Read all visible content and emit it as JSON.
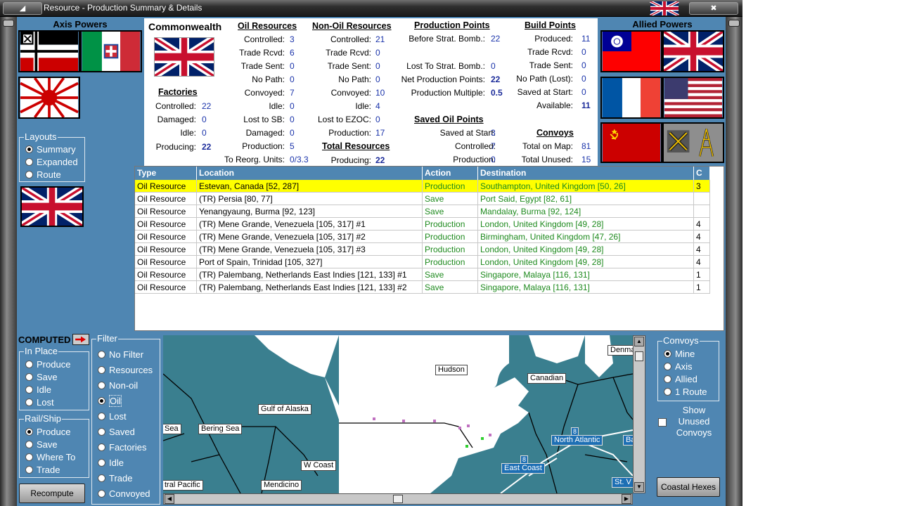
{
  "window": {
    "title": "Resource - Production Summary & Details"
  },
  "axis_header": "Axis Powers",
  "allied_header": "Allied Powers",
  "country": "Commonwealth",
  "factories": {
    "title": "Factories",
    "rows": [
      {
        "label": "Controlled:",
        "value": "22"
      },
      {
        "label": "Damaged:",
        "value": "0"
      },
      {
        "label": "Idle:",
        "value": "0"
      },
      {
        "label": "Producing:",
        "value": "22"
      }
    ]
  },
  "oil": {
    "title": "Oil Resources",
    "rows": [
      {
        "label": "Controlled:",
        "value": "3"
      },
      {
        "label": "Trade Rcvd:",
        "value": "6"
      },
      {
        "label": "Trade Sent:",
        "value": "0"
      },
      {
        "label": "No Path:",
        "value": "0"
      },
      {
        "label": "Convoyed:",
        "value": "7"
      },
      {
        "label": "Idle:",
        "value": "0"
      },
      {
        "label": "Lost to SB:",
        "value": "0"
      },
      {
        "label": "Damaged:",
        "value": "0"
      },
      {
        "label": "Production:",
        "value": "5"
      },
      {
        "label": "To Reorg. Units:",
        "value": "0/3.3"
      }
    ]
  },
  "nonoil": {
    "title": "Non-Oil Resources",
    "rows": [
      {
        "label": "Controlled:",
        "value": "21"
      },
      {
        "label": "Trade Rcvd:",
        "value": "0"
      },
      {
        "label": "Trade Sent:",
        "value": "0"
      },
      {
        "label": "No Path:",
        "value": "0"
      },
      {
        "label": "Convoyed:",
        "value": "10"
      },
      {
        "label": "Idle:",
        "value": "4"
      },
      {
        "label": "Lost to EZOC:",
        "value": "0"
      },
      {
        "label": "Production:",
        "value": "17"
      }
    ]
  },
  "total_resources": {
    "title": "Total Resources",
    "label": "Producing:",
    "value": "22"
  },
  "production_points": {
    "title": "Production Points",
    "rows": [
      {
        "label": "Before Strat. Bomb.:",
        "value": "22"
      },
      {
        "label": "Lost To Strat. Bomb.:",
        "value": "0"
      },
      {
        "label": "Net Production Points:",
        "value": "22"
      },
      {
        "label": "Production Multiple:",
        "value": "0.5"
      }
    ]
  },
  "saved_oil": {
    "title": "Saved Oil Points",
    "rows": [
      {
        "label": "Saved at Start:",
        "value": "3"
      },
      {
        "label": "Controlled:",
        "value": "7"
      },
      {
        "label": "Production:",
        "value": "0"
      }
    ]
  },
  "build_points": {
    "title": "Build Points",
    "rows": [
      {
        "label": "Produced:",
        "value": "11"
      },
      {
        "label": "Trade Rcvd:",
        "value": "0"
      },
      {
        "label": "Trade Sent:",
        "value": "0"
      },
      {
        "label": "No Path (Lost):",
        "value": "0"
      },
      {
        "label": "Saved at Start:",
        "value": "0"
      },
      {
        "label": "Available:",
        "value": "11"
      }
    ]
  },
  "convoys": {
    "title": "Convoys",
    "rows": [
      {
        "label": "Total on Map:",
        "value": "81"
      },
      {
        "label": "Total Unused:",
        "value": "15"
      }
    ]
  },
  "layouts": {
    "title": "Layouts",
    "options": [
      "Summary",
      "Expanded",
      "Route"
    ],
    "selected": 0
  },
  "table": {
    "columns": [
      "Type",
      "Location",
      "Action",
      "Destination",
      "C"
    ],
    "rows": [
      {
        "type": "Oil Resource",
        "location": "Estevan, Canada [52, 287]",
        "action": "Production",
        "destination": "Southampton, United Kingdom [50, 26]",
        "c": "3"
      },
      {
        "type": "Oil Resource",
        "location": "(TR) Persia [80, 77]",
        "action": "Save",
        "destination": "Port Said, Egypt [82, 61]",
        "c": ""
      },
      {
        "type": "Oil Resource",
        "location": "Yenangyaung, Burma [92, 123]",
        "action": "Save",
        "destination": "Mandalay, Burma [92, 124]",
        "c": ""
      },
      {
        "type": "Oil Resource",
        "location": "(TR) Mene Grande, Venezuela [105, 317] #1",
        "action": "Production",
        "destination": "London, United Kingdom [49, 28]",
        "c": "4"
      },
      {
        "type": "Oil Resource",
        "location": "(TR) Mene Grande, Venezuela [105, 317] #2",
        "action": "Production",
        "destination": "Birmingham, United Kingdom [47, 26]",
        "c": "4"
      },
      {
        "type": "Oil Resource",
        "location": "(TR) Mene Grande, Venezuela [105, 317] #3",
        "action": "Production",
        "destination": "London, United Kingdom [49, 28]",
        "c": "4"
      },
      {
        "type": "Oil Resource",
        "location": "Port of Spain, Trinidad [105, 327]",
        "action": "Production",
        "destination": "London, United Kingdom [49, 28]",
        "c": "4"
      },
      {
        "type": "Oil Resource",
        "location": "(TR) Palembang, Netherlands East Indies [121, 133] #1",
        "action": "Save",
        "destination": "Singapore, Malaya [116, 131]",
        "c": "1"
      },
      {
        "type": "Oil Resource",
        "location": "(TR) Palembang, Netherlands East Indies [121, 133] #2",
        "action": "Save",
        "destination": "Singapore, Malaya [116, 131]",
        "c": "1"
      }
    ]
  },
  "computed_label": "COMPUTED",
  "in_place": {
    "title": "In Place",
    "options": [
      "Produce",
      "Save",
      "Idle",
      "Lost"
    ]
  },
  "rail_ship": {
    "title": "Rail/Ship",
    "options": [
      "Produce",
      "Save",
      "Where To",
      "Trade"
    ],
    "selected": 0
  },
  "filter": {
    "title": "Filter",
    "options": [
      "No Filter",
      "Resources",
      "Non-oil",
      "Oil",
      "Lost",
      "Saved",
      "Factories",
      "Idle",
      "Trade",
      "Convoyed"
    ],
    "selected": 3
  },
  "recompute_label": "Recompute",
  "convoys_filter": {
    "title": "Convoys",
    "options": [
      "Mine",
      "Axis",
      "Allied",
      "1 Route"
    ],
    "selected": 0
  },
  "show_unused": "Show Unused Convoys",
  "coastal_hexes_label": "Coastal Hexes",
  "map": {
    "labels": [
      "Hudson",
      "Canadian",
      "Denma",
      "Gulf of Alaska",
      "Sea",
      "Bering Sea",
      "W Coast",
      "Mendicino",
      "tral Pacific"
    ],
    "sea_labels": [
      "North Atlantic",
      "East Coast",
      "St. V",
      "Ba"
    ],
    "convoy_counts": [
      "8",
      "8"
    ]
  },
  "colors": {
    "panel_blue": "#4f86b2",
    "highlight": "#ffff00",
    "value_blue": "#1a33aa",
    "action_green": "#1e8a1e"
  }
}
